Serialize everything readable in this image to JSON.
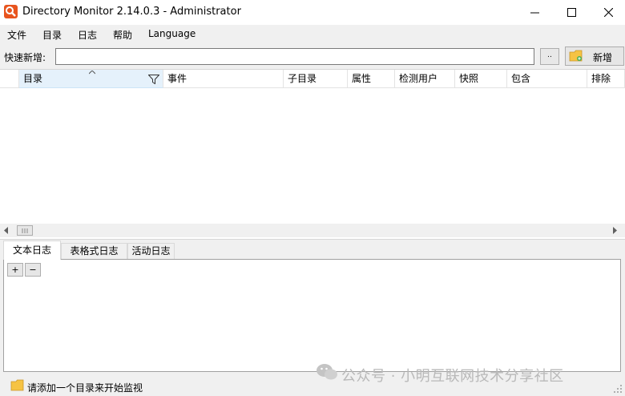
{
  "window": {
    "title": "Directory Monitor 2.14.0.3 - Administrator",
    "minimize_glyph": "—",
    "maximize_glyph": "☐",
    "close_glyph": "✕"
  },
  "menu": {
    "items": [
      "文件",
      "目录",
      "日志",
      "帮助",
      "Language"
    ]
  },
  "quick_add": {
    "label": "快速新增:",
    "value": "",
    "browse_label": "..",
    "add_label": "新增"
  },
  "grid": {
    "columns": [
      "目录",
      "事件",
      "子目录",
      "属性",
      "检测用户",
      "快照",
      "包含",
      "排除"
    ],
    "selected_column": "目录",
    "rows": []
  },
  "tabs": {
    "items": [
      "文本日志",
      "表格式日志",
      "活动日志"
    ],
    "active": "文本日志"
  },
  "log_toolbar": {
    "expand_label": "+",
    "collapse_label": "−"
  },
  "status": {
    "text": "请添加一个目录来开始监视"
  },
  "watermark": {
    "text": "公众号 · 小明互联网技术分享社区"
  },
  "colors": {
    "app_icon": "#e8541e",
    "folder": "#f6c343",
    "selected_header": "#e5f1fb"
  }
}
